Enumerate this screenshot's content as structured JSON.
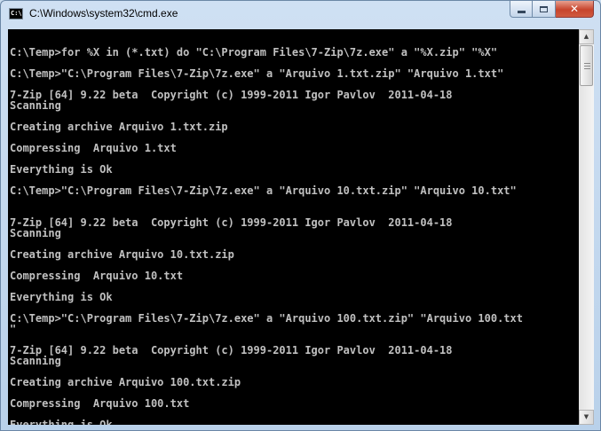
{
  "window": {
    "title": "C:\\Windows\\system32\\cmd.exe",
    "icon": "command-prompt-icon",
    "controls": {
      "minimize": "minimize-icon",
      "maximize": "maximize-icon",
      "close": "close-icon"
    }
  },
  "console": {
    "lines": [
      "",
      "C:\\Temp>for %X in (*.txt) do \"C:\\Program Files\\7-Zip\\7z.exe\" a \"%X.zip\" \"%X\"",
      "",
      "C:\\Temp>\"C:\\Program Files\\7-Zip\\7z.exe\" a \"Arquivo 1.txt.zip\" \"Arquivo 1.txt\"",
      "",
      "7-Zip [64] 9.22 beta  Copyright (c) 1999-2011 Igor Pavlov  2011-04-18",
      "Scanning",
      "",
      "Creating archive Arquivo 1.txt.zip",
      "",
      "Compressing  Arquivo 1.txt",
      "",
      "Everything is Ok",
      "",
      "C:\\Temp>\"C:\\Program Files\\7-Zip\\7z.exe\" a \"Arquivo 10.txt.zip\" \"Arquivo 10.txt\"",
      "",
      "",
      "7-Zip [64] 9.22 beta  Copyright (c) 1999-2011 Igor Pavlov  2011-04-18",
      "Scanning",
      "",
      "Creating archive Arquivo 10.txt.zip",
      "",
      "Compressing  Arquivo 10.txt",
      "",
      "Everything is Ok",
      "",
      "C:\\Temp>\"C:\\Program Files\\7-Zip\\7z.exe\" a \"Arquivo 100.txt.zip\" \"Arquivo 100.txt",
      "\"",
      "",
      "7-Zip [64] 9.22 beta  Copyright (c) 1999-2011 Igor Pavlov  2011-04-18",
      "Scanning",
      "",
      "Creating archive Arquivo 100.txt.zip",
      "",
      "Compressing  Arquivo 100.txt",
      "",
      "Everything is Ok"
    ],
    "text_color": "#c0c0c0",
    "background_color": "#000000"
  },
  "scrollbar": {
    "up": "scroll-up-arrow-icon",
    "down": "scroll-down-arrow-icon",
    "thumb": "scrollbar-thumb"
  }
}
